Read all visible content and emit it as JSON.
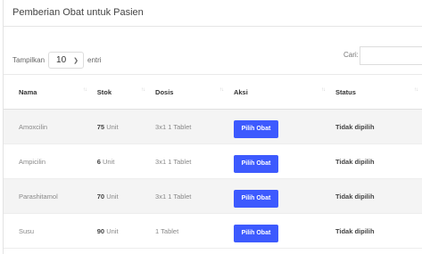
{
  "page": {
    "title": "Pemberian Obat untuk Pasien"
  },
  "controls": {
    "show_label": "Tampilkan",
    "entries_value": "10",
    "entries_suffix": "entri",
    "search_label": "Cari:",
    "search_value": ""
  },
  "table": {
    "headers": {
      "name": "Nama",
      "stock": "Stok",
      "dose": "Dosis",
      "action": "Aksi",
      "status": "Status"
    },
    "rows": [
      {
        "name": "Amoxcilin",
        "stock_num": "75",
        "stock_unit": "Unit",
        "dose": "3x1 1 Tablet",
        "action": "Pilih Obat",
        "status": "Tidak dipilih"
      },
      {
        "name": "Ampicilin",
        "stock_num": "6",
        "stock_unit": "Unit",
        "dose": "3x1 1 Tablet",
        "action": "Pilih Obat",
        "status": "Tidak dipilih"
      },
      {
        "name": "Parashitamol",
        "stock_num": "70",
        "stock_unit": "Unit",
        "dose": "3x1 1 Tablet",
        "action": "Pilih Obat",
        "status": "Tidak dipilih"
      },
      {
        "name": "Susu",
        "stock_num": "90",
        "stock_unit": "Unit",
        "dose": "1 Tablet",
        "action": "Pilih Obat",
        "status": "Tidak dipilih"
      }
    ]
  },
  "colors": {
    "button": "#3d5afe",
    "stripe": "#f4f4f4"
  },
  "icons": {
    "sort": "sort-arrows-icon",
    "dropdown": "chevron-down-icon"
  }
}
